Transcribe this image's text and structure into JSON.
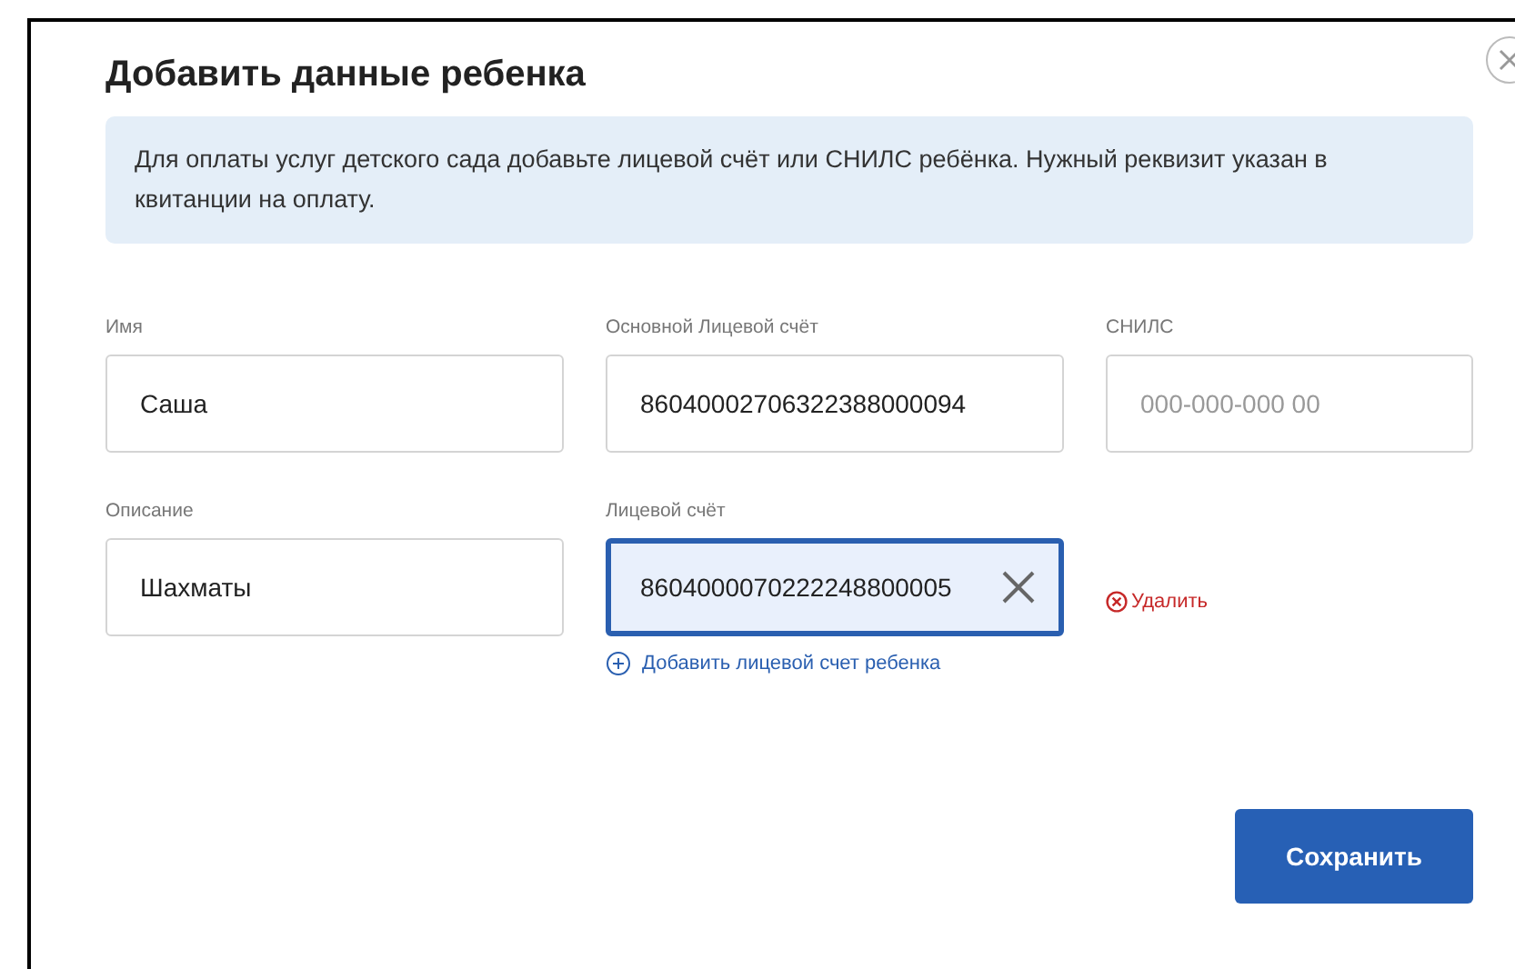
{
  "dialog": {
    "title": "Добавить данные ребенка",
    "notice": "Для оплаты услуг детского сада добавьте лицевой счёт или СНИЛС ребёнка. Нужный реквизит указан в квитанции на оплату.",
    "fields": [
      {
        "label": "Имя",
        "value": "Саша",
        "focused": false
      },
      {
        "label": "Основной Лицевой счёт",
        "value": "86040002706322388000094",
        "focused": false
      },
      {
        "label": "СНИЛС",
        "placeholder": "000-000-000 00",
        "focused": false
      },
      {
        "label": "Описание",
        "value": "Шахматы",
        "focused": false
      },
      {
        "label": "Лицевой счёт",
        "value": "8604000070222248800005",
        "focused": true
      }
    ],
    "delete_link": "Удалить",
    "add_link": "Добавить лицевой счет ребенка",
    "save_button": "Сохранить"
  }
}
